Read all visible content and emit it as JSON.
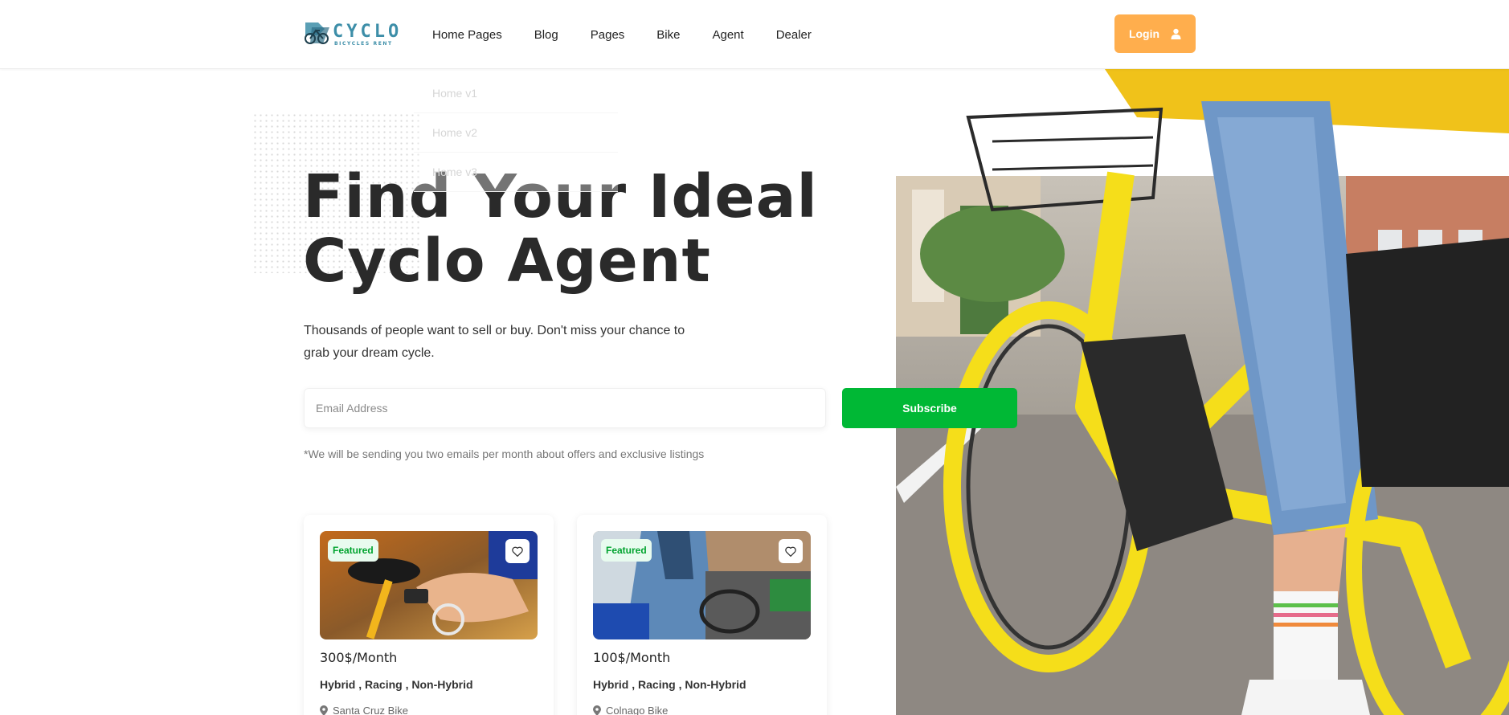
{
  "brand": {
    "name": "CYCLO",
    "tagline": "BICYCLES RENT",
    "logo_color": "#3d8ea8"
  },
  "nav": {
    "items": [
      {
        "label": "Home Pages"
      },
      {
        "label": "Blog"
      },
      {
        "label": "Pages"
      },
      {
        "label": "Bike"
      },
      {
        "label": "Agent"
      },
      {
        "label": "Dealer"
      }
    ],
    "login_label": "Login",
    "login_icon": "user-icon",
    "login_color": "#ffae4d"
  },
  "dropdown": {
    "items": [
      {
        "label": "Home v1"
      },
      {
        "label": "Home v2"
      },
      {
        "label": "Home v3"
      }
    ]
  },
  "hero": {
    "title_line1": "Find Your Ideal",
    "title_line2": "Cyclo Agent",
    "subtitle": "Thousands of people want to sell or buy. Don't miss your chance to grab your dream cycle.",
    "email_placeholder": "Email Address",
    "subscribe_label": "Subscribe",
    "subscribe_color": "#00b835",
    "disclaimer": "*We will be sending you two emails per month about offers and exclusive listings"
  },
  "cards": [
    {
      "badge": "Featured",
      "price": "300$/Month",
      "tags": "Hybrid , Racing , Non-Hybrid",
      "location": "Santa Cruz Bike"
    },
    {
      "badge": "Featured",
      "price": "100$/Month",
      "tags": "Hybrid , Racing , Non-Hybrid",
      "location": "Colnago Bike"
    }
  ]
}
